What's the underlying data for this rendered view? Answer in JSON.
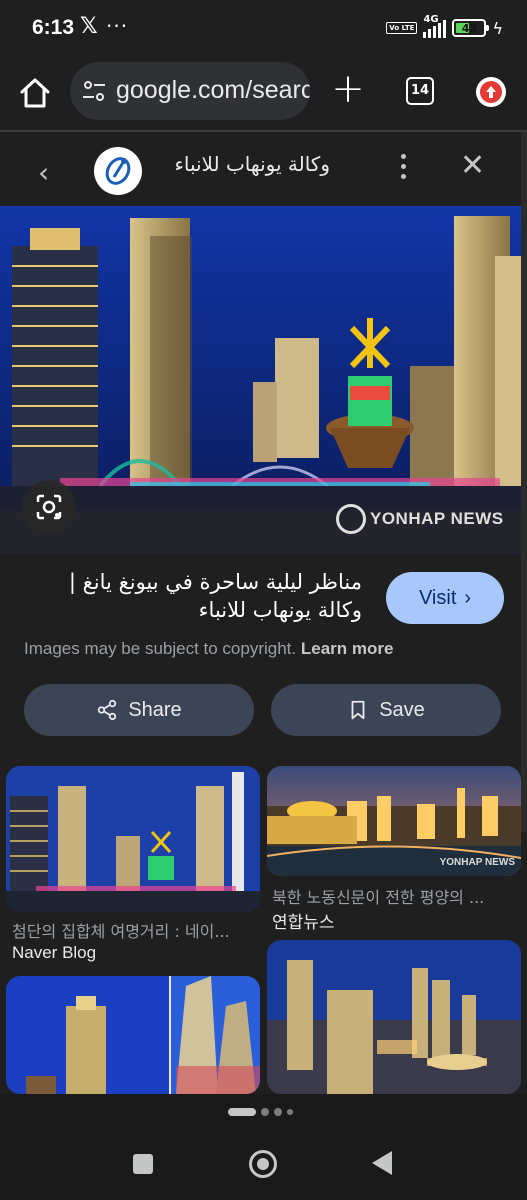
{
  "status_bar": {
    "time": "6:13",
    "x_icon": "𝕏",
    "more": "···",
    "volte": "Vo LTE",
    "network": "4G",
    "battery": "43"
  },
  "browser": {
    "url": "google.com/search",
    "tab_count": "14"
  },
  "panel": {
    "source_name": "وكالة يونهاب للانباء"
  },
  "image": {
    "watermark": "YONHAP NEWS"
  },
  "result": {
    "title": "مناظر ليلية ساحرة في بيونغ يانغ | وكالة يونهاب للانباء",
    "visit_label": "Visit",
    "copyright_text": "Images may be subject to copyright.",
    "learn_more": "Learn more",
    "share_label": "Share",
    "save_label": "Save"
  },
  "related": [
    {
      "caption": "첨단의 집합체 여명거리 : 네이...",
      "source": "Naver Blog"
    },
    {
      "caption": "북한 노동신문이 전한 평양의 ...",
      "source": "연합뉴스",
      "watermark": "YONHAP NEWS"
    },
    {
      "caption": "",
      "source": ""
    },
    {
      "caption": "",
      "source": ""
    }
  ],
  "colors": {
    "background": "#1f1f1f",
    "visit_button": "#a8c7fa",
    "action_button": "#3c4555",
    "update_badge": "#e53935",
    "battery_fill": "#5ed35a"
  },
  "pager": {
    "active_index": 0,
    "total": 4
  }
}
